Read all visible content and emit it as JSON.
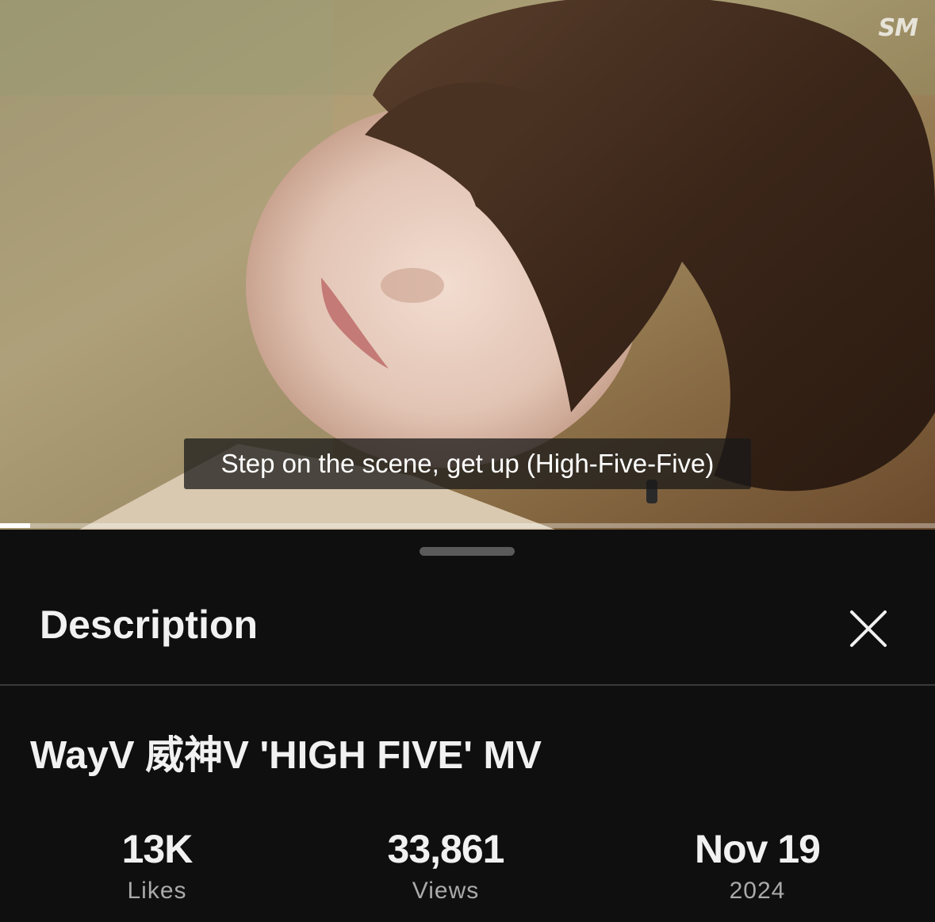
{
  "player": {
    "caption": "Step on the scene, get up (High-Five-Five)",
    "watermark": "SM",
    "progress_fraction": 0.032
  },
  "sheet": {
    "title": "Description",
    "close_icon": "close-icon"
  },
  "video": {
    "title": "WayV 威神V 'HIGH FIVE' MV"
  },
  "stats": [
    {
      "value": "13K",
      "label": "Likes"
    },
    {
      "value": "33,861",
      "label": "Views"
    },
    {
      "value": "Nov 19",
      "label": "2024"
    }
  ],
  "colors": {
    "background": "#0f0f0f",
    "text_primary": "#f1f1f1",
    "text_secondary": "#aaaaaa",
    "divider": "#3a3a3a"
  }
}
